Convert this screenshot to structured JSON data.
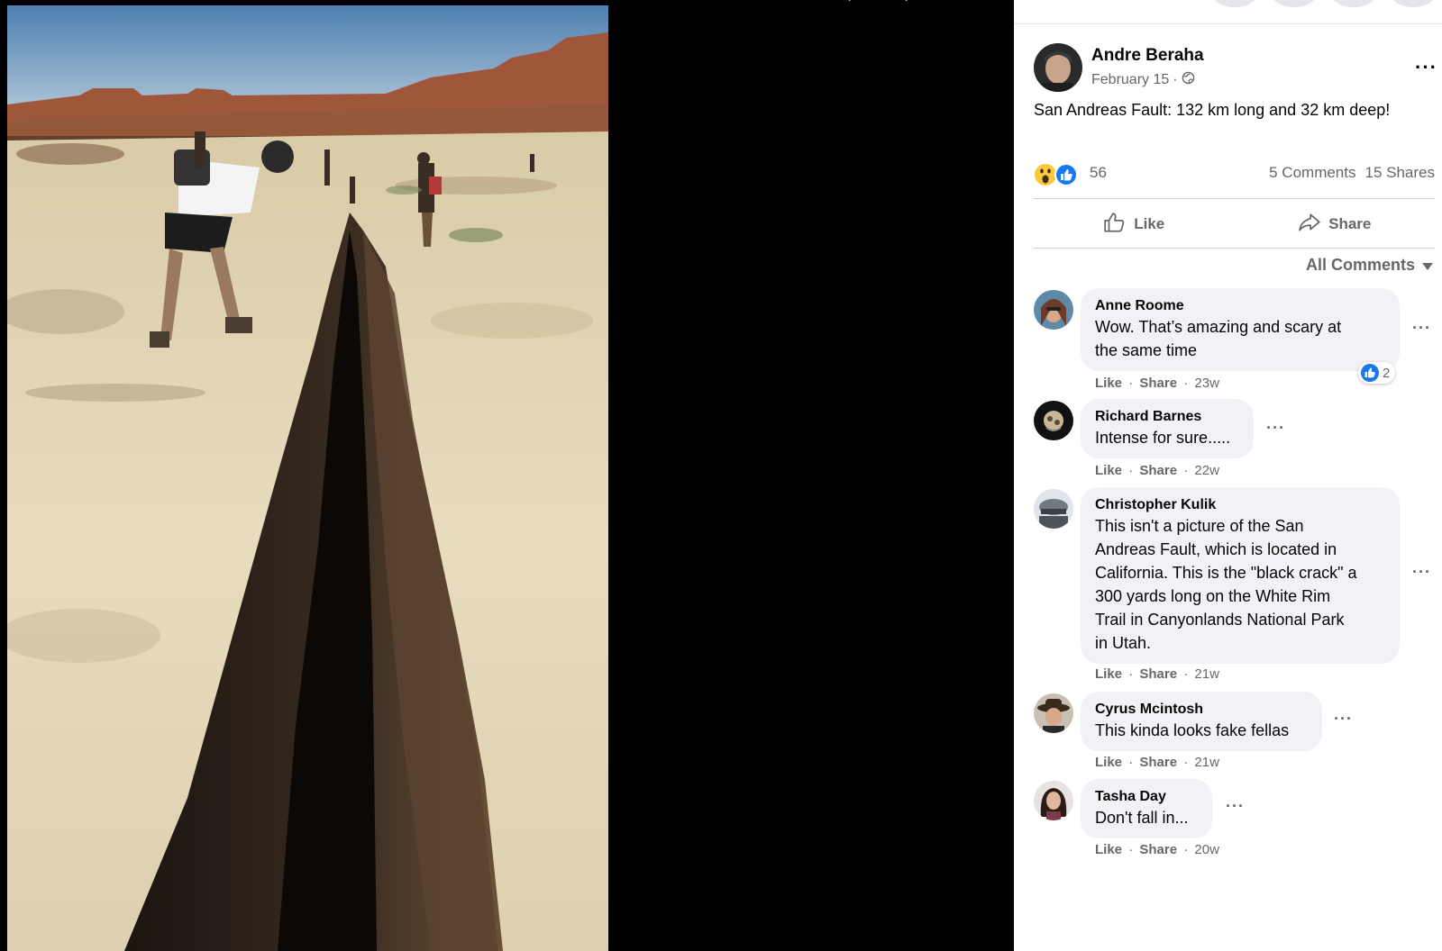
{
  "post": {
    "author": "Andre Beraha",
    "date": "February 15",
    "date_separator": "·",
    "text": "San Andreas Fault: 132 km long and 32 km deep!",
    "reaction_count": "56",
    "comments_count": "5 Comments",
    "shares_count": "15 Shares",
    "like_label": "Like",
    "share_label": "Share",
    "all_comments_label": "All Comments"
  },
  "comments": [
    {
      "name": "Anne Roome",
      "text_lines": [
        "Wow. That’s amazing and scary at",
        "the same time"
      ],
      "like": "Like",
      "share": "Share",
      "sep": "·",
      "time": "23w",
      "reactions": "2"
    },
    {
      "name": "Richard Barnes",
      "text_lines": [
        "Intense for sure....."
      ],
      "like": "Like",
      "share": "Share",
      "sep": "·",
      "time": "22w"
    },
    {
      "name": "Christopher Kulik",
      "text_lines": [
        "This isn't a picture of the San",
        "Andreas Fault, which is located in",
        "California. This is the \"black crack\" a",
        "300 yards long on the White Rim",
        "Trail in Canyonlands National Park",
        "in Utah."
      ],
      "like": "Like",
      "share": "Share",
      "sep": "·",
      "time": "21w"
    },
    {
      "name": "Cyrus Mcintosh",
      "text_lines": [
        "This kinda looks fake fellas"
      ],
      "like": "Like",
      "share": "Share",
      "sep": "·",
      "time": "21w"
    },
    {
      "name": "Tasha Day",
      "text_lines": [
        "Don't fall in..."
      ],
      "like": "Like",
      "share": "Share",
      "sep": "·",
      "time": "20w"
    }
  ],
  "icons": {
    "more": "more-horizontal-icon",
    "globe": "globe-icon",
    "like": "thumbs-up-icon",
    "share": "share-arrow-icon",
    "wow": "wow-reaction-icon",
    "like_reaction": "like-reaction-icon",
    "caret": "caret-down-icon"
  },
  "colors": {
    "facebook_blue": "#1877f2",
    "secondary_text": "#65676b",
    "bubble_bg": "#f0f2f5"
  }
}
